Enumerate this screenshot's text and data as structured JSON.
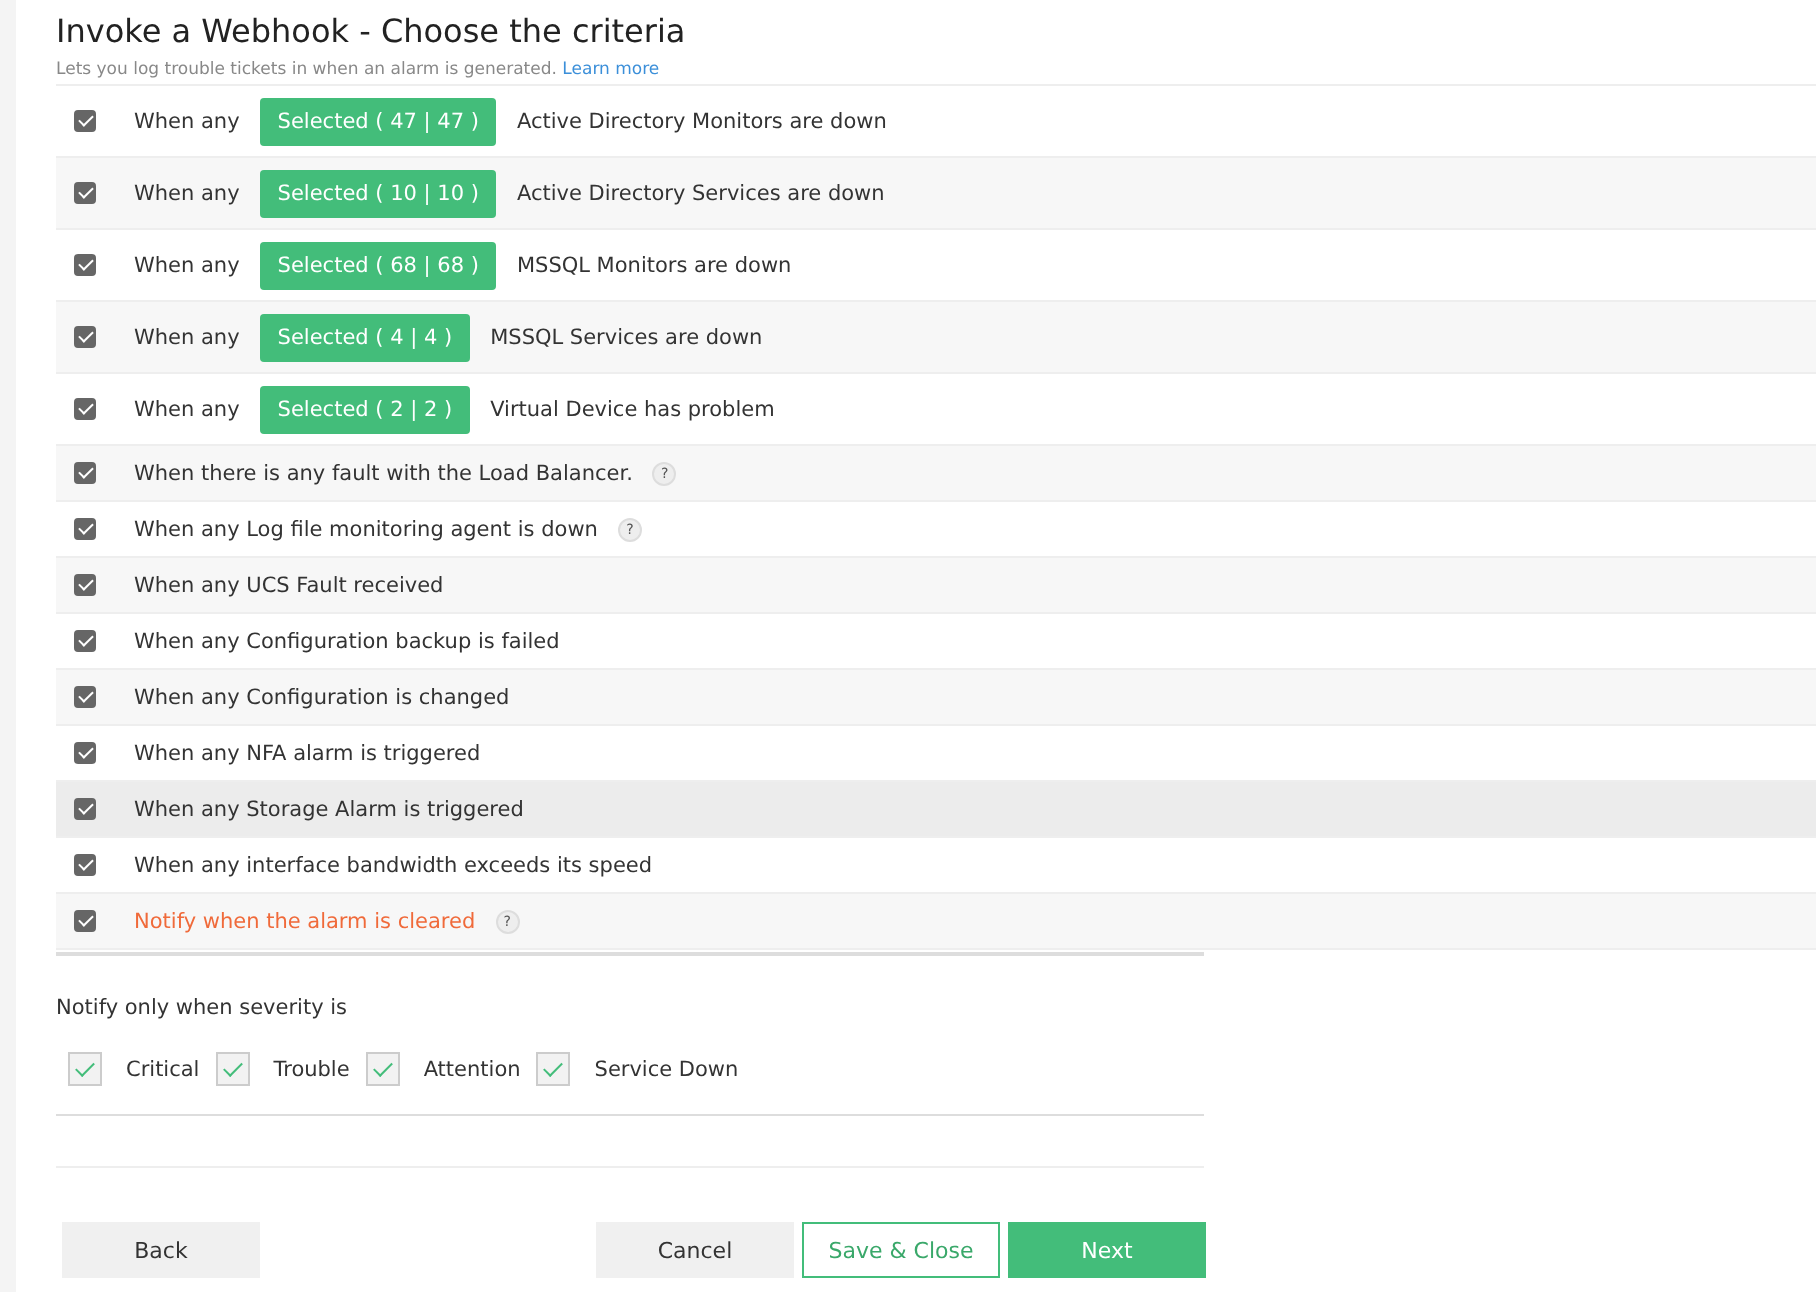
{
  "header": {
    "title": "Invoke a Webhook - Choose the criteria",
    "subtitle": "Lets you log trouble tickets in when an alarm is generated.",
    "link": "Learn more"
  },
  "criteria": [
    {
      "kind": "selection",
      "checked": true,
      "prefix": "When any",
      "selection": "Selected ( 47 | 47 )",
      "text": "Active Directory Monitors are down",
      "highlighted": false
    },
    {
      "kind": "selection",
      "checked": true,
      "prefix": "When any",
      "selection": "Selected ( 10 | 10 )",
      "text": "Active Directory Services are down",
      "highlighted": false
    },
    {
      "kind": "selection",
      "checked": true,
      "prefix": "When any",
      "selection": "Selected ( 68 | 68 )",
      "text": "MSSQL Monitors are down",
      "highlighted": false
    },
    {
      "kind": "selection",
      "checked": true,
      "prefix": "When any",
      "selection": "Selected ( 4 | 4 )",
      "text": "MSSQL Services are down",
      "highlighted": false
    },
    {
      "kind": "selection",
      "checked": true,
      "prefix": "When any",
      "selection": "Selected ( 2 | 2 )",
      "text": "Virtual Device has problem",
      "highlighted": false
    },
    {
      "kind": "plain",
      "checked": true,
      "text": "When there is any fault with the Load Balancer.",
      "help": "?",
      "highlighted": false
    },
    {
      "kind": "plain",
      "checked": true,
      "text": "When any Log file monitoring agent is down",
      "help": "?",
      "highlighted": false
    },
    {
      "kind": "plain",
      "checked": true,
      "text": "When any UCS Fault received",
      "highlighted": false
    },
    {
      "kind": "plain",
      "checked": true,
      "text": "When any Configuration backup is failed",
      "highlighted": false
    },
    {
      "kind": "plain",
      "checked": true,
      "text": "When any Configuration is changed",
      "highlighted": false
    },
    {
      "kind": "plain",
      "checked": true,
      "text": "When any NFA alarm is triggered",
      "highlighted": false
    },
    {
      "kind": "plain",
      "checked": true,
      "text": "When any Storage Alarm is triggered",
      "highlighted": true
    },
    {
      "kind": "plain",
      "checked": true,
      "text": "When any interface bandwidth exceeds its speed",
      "highlighted": false
    },
    {
      "kind": "alert",
      "checked": true,
      "text": "Notify when the alarm is cleared",
      "help": "?",
      "highlighted": false
    }
  ],
  "severity": {
    "label": "Notify only when severity is",
    "options": [
      {
        "label": "Critical",
        "checked": true
      },
      {
        "label": "Trouble",
        "checked": true
      },
      {
        "label": "Attention",
        "checked": true
      },
      {
        "label": "Service Down",
        "checked": true
      }
    ]
  },
  "buttons": {
    "back": "Back",
    "cancel": "Cancel",
    "save": "Save & Close",
    "next": "Next"
  }
}
